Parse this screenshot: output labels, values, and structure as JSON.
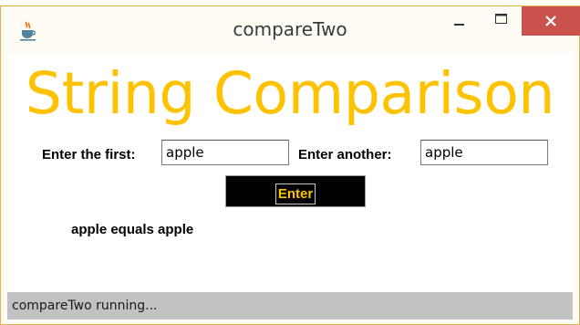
{
  "window": {
    "title": "compareTwo",
    "icon": "java-coffee-cup-icon",
    "controls": [
      "minimize-icon",
      "maximize-icon",
      "close-icon"
    ]
  },
  "main": {
    "heading": "String Comparison",
    "first_label": "Enter the first:",
    "first_value": "apple",
    "another_label": "Enter another:",
    "another_value": "apple",
    "enter_label": "Enter",
    "result": "apple equals apple"
  },
  "status": {
    "text": "compareTwo running..."
  },
  "colors": {
    "heading": "#ffc200",
    "button_bg": "#000000",
    "button_text": "#ffc200",
    "close_button": "#c9524c",
    "statusbar": "#c2c2c2"
  }
}
